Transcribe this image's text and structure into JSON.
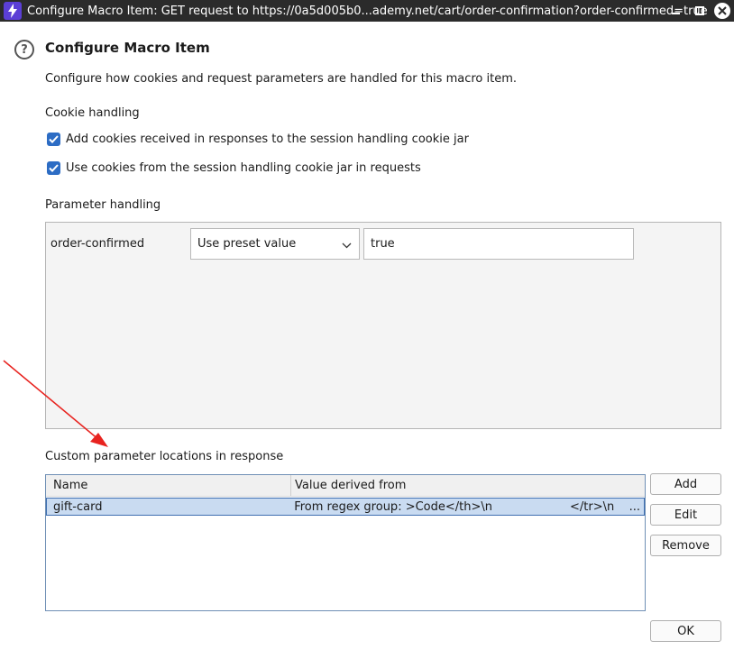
{
  "window": {
    "title": "Configure Macro Item: GET request to https://0a5d005b0...ademy.net/cart/order-confirmation?order-confirmed=true",
    "app_icon": "lightning-icon",
    "controls": [
      "minimize-icon",
      "maximize-icon",
      "close-icon"
    ]
  },
  "dialog": {
    "heading": "Configure Macro Item",
    "description": "Configure how cookies and request parameters are handled for this macro item."
  },
  "cookie_handling": {
    "label": "Cookie handling",
    "options": [
      {
        "label": "Add cookies received in responses to the session handling cookie jar",
        "checked": true
      },
      {
        "label": "Use cookies from the session handling cookie jar in requests",
        "checked": true
      }
    ]
  },
  "parameter_handling": {
    "label": "Parameter handling",
    "rows": [
      {
        "name": "order-confirmed",
        "mode": "Use preset value",
        "value": "true"
      }
    ]
  },
  "custom_locations": {
    "label": "Custom parameter locations in response",
    "columns": [
      "Name",
      "Value derived from"
    ],
    "rows": [
      {
        "name": "gift-card",
        "derived_part1": "From regex group: >Code</th>\\n",
        "derived_part2": "</tr>\\n",
        "ellipsis": "..."
      }
    ],
    "buttons": {
      "add": "Add",
      "edit": "Edit",
      "remove": "Remove"
    }
  },
  "footer": {
    "ok": "OK"
  },
  "colors": {
    "titlebar": "#2b2b2b",
    "accent": "#2c6cc4",
    "selection": "#c9dbf1",
    "annotation_arrow": "#e8231f"
  }
}
